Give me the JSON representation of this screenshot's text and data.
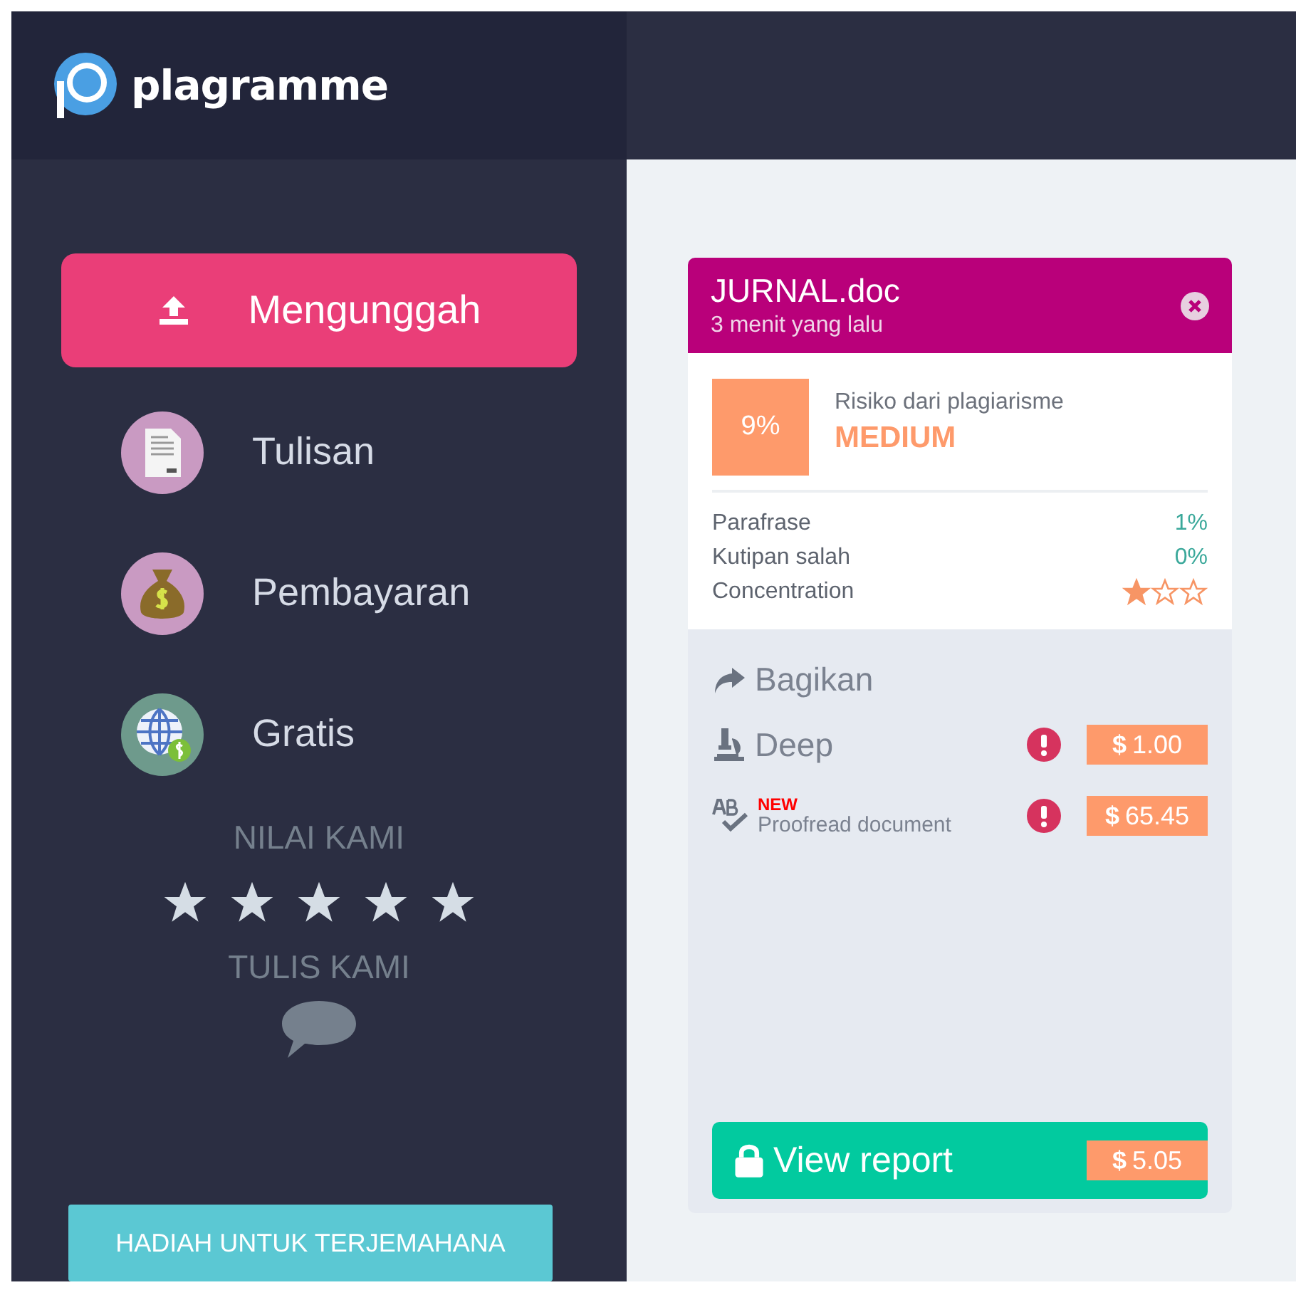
{
  "logo": {
    "name": "plagramme"
  },
  "sidebar": {
    "items": [
      {
        "label": "Mengunggah",
        "kind": "upload",
        "selected": true
      },
      {
        "label": "Tulisan",
        "kind": "document",
        "selected": false
      },
      {
        "label": "Pembayaran",
        "kind": "money",
        "selected": false
      },
      {
        "label": "Gratis",
        "kind": "globe",
        "selected": false
      }
    ],
    "rate_heading": "NILAI KAMI",
    "write_heading": "TULIS KAMI",
    "promo_button": "HADIAH UNTUK TERJEMAHANA"
  },
  "card": {
    "file_name": "JURNAL.doc",
    "time": "3 menit yang lalu",
    "score": "9%",
    "risk_label": "Risiko dari plagiarisme",
    "risk_level": "MEDIUM",
    "metrics": [
      {
        "label": "Parafrase",
        "kind": "value",
        "value": "1%"
      },
      {
        "label": "Kutipan salah",
        "kind": "value",
        "value": "0%"
      },
      {
        "label": "Concentration",
        "kind": "stars",
        "stars": 1
      }
    ],
    "share": "Bagikan",
    "services": [
      {
        "label": "Deep",
        "kind": "deep",
        "price": "**$** 1.00"
      },
      {
        "label": "Proofread document",
        "kind": "proofread",
        "badge": "NEW",
        "price": "**$** 65.45"
      }
    ],
    "report_button": "View report",
    "report_price": "**$** 5.05"
  }
}
